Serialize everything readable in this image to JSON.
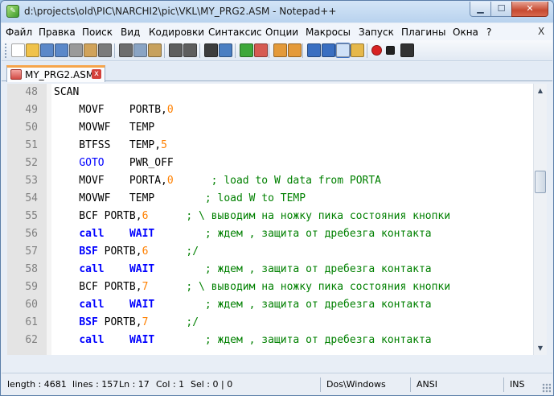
{
  "window": {
    "title": "d:\\projects\\old\\PIC\\NARCHI2\\pic\\VKL\\MY_PRG2.ASM - Notepad++",
    "icon": "notepadpp-icon"
  },
  "menu": {
    "items": [
      {
        "label": "Файл"
      },
      {
        "label": "Правка"
      },
      {
        "label": "Поиск"
      },
      {
        "label": "Вид"
      },
      {
        "label": "Кодировки"
      },
      {
        "label": "Синтаксис"
      },
      {
        "label": "Опции"
      },
      {
        "label": "Макросы"
      },
      {
        "label": "Запуск"
      },
      {
        "label": "Плагины"
      },
      {
        "label": "Окна"
      },
      {
        "label": "?"
      }
    ],
    "close_glyph": "X"
  },
  "toolbar": {
    "icons": [
      {
        "name": "new-file-icon",
        "color": "#ffffff"
      },
      {
        "name": "open-file-icon",
        "color": "#f0c24a"
      },
      {
        "name": "save-icon",
        "color": "#5b88c9"
      },
      {
        "name": "save-all-icon",
        "color": "#5b88c9"
      },
      {
        "name": "close-icon",
        "color": "#9a9a9a"
      },
      {
        "name": "close-all-icon",
        "color": "#d1a35a"
      },
      {
        "name": "print-icon",
        "color": "#7b7b7b"
      },
      {
        "name": "cut-icon",
        "color": "#6d6d6d"
      },
      {
        "name": "copy-icon",
        "color": "#8aa4c4"
      },
      {
        "name": "paste-icon",
        "color": "#c7a15d"
      },
      {
        "name": "undo-icon",
        "color": "#5e5e5e"
      },
      {
        "name": "redo-icon",
        "color": "#5e5e5e"
      },
      {
        "name": "find-icon",
        "color": "#3d3d3d"
      },
      {
        "name": "replace-icon",
        "color": "#4b7fc2"
      },
      {
        "name": "zoom-in-icon",
        "color": "#3fa83a"
      },
      {
        "name": "zoom-out-icon",
        "color": "#d65b52"
      },
      {
        "name": "sync-v-icon",
        "color": "#e49a3a"
      },
      {
        "name": "sync-h-icon",
        "color": "#e49a3a"
      },
      {
        "name": "wrap-icon",
        "color": "#3a6fc1"
      },
      {
        "name": "all-chars-icon",
        "color": "#3a6fc1"
      },
      {
        "name": "indent-guide-icon",
        "color": "#3a6fc1"
      },
      {
        "name": "doc-map-icon",
        "color": "#e6b84a"
      },
      {
        "name": "record-macro-icon",
        "color": "#d82222"
      },
      {
        "name": "stop-record-icon",
        "color": "#222222"
      },
      {
        "name": "play-macro-icon",
        "color": "#333333"
      }
    ]
  },
  "tabs": [
    {
      "label": "MY_PRG2.ASM",
      "close_glyph": "x"
    }
  ],
  "editor": {
    "lines": [
      {
        "num": "48",
        "tokens": [
          {
            "t": "SCAN",
            "c": "tk-plain"
          }
        ]
      },
      {
        "num": "49",
        "tokens": [
          {
            "t": "    MOVF    PORTB,",
            "c": "tk-plain"
          },
          {
            "t": "0",
            "c": "tk-num"
          }
        ]
      },
      {
        "num": "50",
        "tokens": [
          {
            "t": "    MOVWF   TEMP",
            "c": "tk-plain"
          }
        ]
      },
      {
        "num": "51",
        "tokens": [
          {
            "t": "    BTFSS   TEMP,",
            "c": "tk-plain"
          },
          {
            "t": "5",
            "c": "tk-num"
          }
        ]
      },
      {
        "num": "52",
        "tokens": [
          {
            "t": "    ",
            "c": "tk-plain"
          },
          {
            "t": "GOTO",
            "c": "tk-kwn"
          },
          {
            "t": "    PWR_OFF",
            "c": "tk-plain"
          }
        ]
      },
      {
        "num": "53",
        "tokens": [
          {
            "t": "    MOVF    PORTA,",
            "c": "tk-plain"
          },
          {
            "t": "0",
            "c": "tk-num"
          },
          {
            "t": "      ; load to W data from PORTA",
            "c": "tk-com"
          }
        ]
      },
      {
        "num": "54",
        "tokens": [
          {
            "t": "    MOVWF   TEMP        ",
            "c": "tk-plain"
          },
          {
            "t": "; load W to TEMP",
            "c": "tk-com"
          }
        ]
      },
      {
        "num": "55",
        "tokens": [
          {
            "t": "    BCF PORTB,",
            "c": "tk-plain"
          },
          {
            "t": "6",
            "c": "tk-num"
          },
          {
            "t": "      ; \\ выводим на ножку пика состояния кнопки",
            "c": "tk-com"
          }
        ]
      },
      {
        "num": "56",
        "tokens": [
          {
            "t": "    ",
            "c": "tk-plain"
          },
          {
            "t": "call",
            "c": "tk-kw"
          },
          {
            "t": "    ",
            "c": "tk-plain"
          },
          {
            "t": "WAIT",
            "c": "tk-kw"
          },
          {
            "t": "        ; ждем , защита от дребезга контакта",
            "c": "tk-com"
          }
        ]
      },
      {
        "num": "57",
        "tokens": [
          {
            "t": "    ",
            "c": "tk-plain"
          },
          {
            "t": "BSF",
            "c": "tk-kw"
          },
          {
            "t": " PORTB,",
            "c": "tk-plain"
          },
          {
            "t": "6",
            "c": "tk-num"
          },
          {
            "t": "      ;/",
            "c": "tk-com"
          }
        ]
      },
      {
        "num": "58",
        "tokens": [
          {
            "t": "    ",
            "c": "tk-plain"
          },
          {
            "t": "call",
            "c": "tk-kw"
          },
          {
            "t": "    ",
            "c": "tk-plain"
          },
          {
            "t": "WAIT",
            "c": "tk-kw"
          },
          {
            "t": "        ; ждем , защита от дребезга контакта",
            "c": "tk-com"
          }
        ]
      },
      {
        "num": "59",
        "tokens": [
          {
            "t": "    BCF PORTB,",
            "c": "tk-plain"
          },
          {
            "t": "7",
            "c": "tk-num"
          },
          {
            "t": "      ; \\ выводим на ножку пика состояния кнопки",
            "c": "tk-com"
          }
        ]
      },
      {
        "num": "60",
        "tokens": [
          {
            "t": "    ",
            "c": "tk-plain"
          },
          {
            "t": "call",
            "c": "tk-kw"
          },
          {
            "t": "    ",
            "c": "tk-plain"
          },
          {
            "t": "WAIT",
            "c": "tk-kw"
          },
          {
            "t": "        ; ждем , защита от дребезга контакта",
            "c": "tk-com"
          }
        ]
      },
      {
        "num": "61",
        "tokens": [
          {
            "t": "    ",
            "c": "tk-plain"
          },
          {
            "t": "BSF",
            "c": "tk-kw"
          },
          {
            "t": " PORTB,",
            "c": "tk-plain"
          },
          {
            "t": "7",
            "c": "tk-num"
          },
          {
            "t": "      ;/",
            "c": "tk-com"
          }
        ]
      },
      {
        "num": "62",
        "tokens": [
          {
            "t": "    ",
            "c": "tk-plain"
          },
          {
            "t": "call",
            "c": "tk-kw"
          },
          {
            "t": "    ",
            "c": "tk-plain"
          },
          {
            "t": "WAIT",
            "c": "tk-kw"
          },
          {
            "t": "        ; ждем , защита от дребезга контакта",
            "c": "tk-com"
          }
        ]
      }
    ]
  },
  "statusbar": {
    "length": "length : 4681",
    "lines": "lines : 157",
    "ln": "Ln : 17",
    "col": "Col : 1",
    "sel": "Sel : 0 | 0",
    "eol": "Dos\\Windows",
    "encoding": "ANSI",
    "mode": "INS"
  },
  "colors": {
    "comment": "#008000",
    "number": "#ff8000",
    "keyword": "#0000ff",
    "tab_accent": "#f6a54a"
  }
}
